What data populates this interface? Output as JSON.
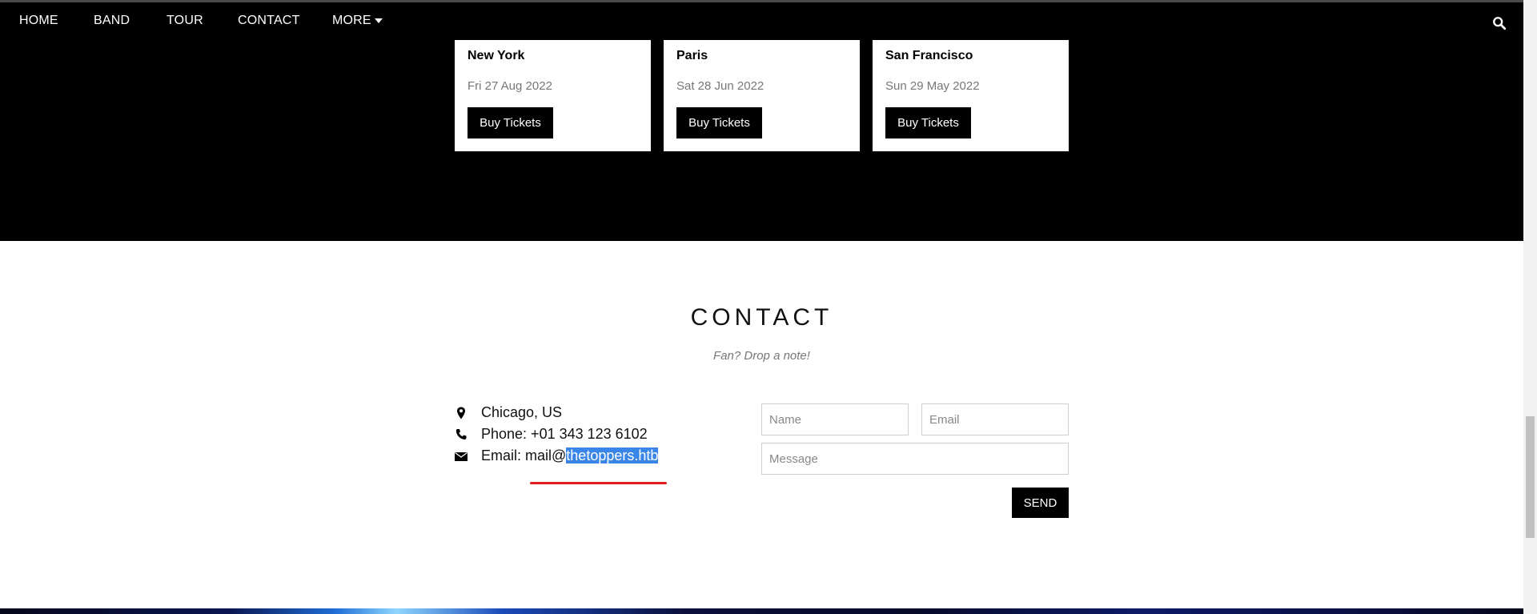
{
  "nav": {
    "items": [
      "HOME",
      "BAND",
      "TOUR",
      "CONTACT",
      "MORE"
    ],
    "search_icon": "search-icon"
  },
  "tour": {
    "cards": [
      {
        "city": "New York",
        "date": "Fri 27 Aug 2022",
        "button": "Buy Tickets"
      },
      {
        "city": "Paris",
        "date": "Sat 28 Jun 2022",
        "button": "Buy Tickets"
      },
      {
        "city": "San Francisco",
        "date": "Sun 29 May 2022",
        "button": "Buy Tickets"
      }
    ]
  },
  "contact": {
    "title": "CONTACT",
    "subtitle": "Fan? Drop a note!",
    "location": "Chicago, US",
    "phone": "Phone: +01 343 123 6102",
    "email_prefix": "Email: mail@",
    "email_domain": "thetoppers.htb",
    "form": {
      "name_placeholder": "Name",
      "email_placeholder": "Email",
      "message_placeholder": "Message",
      "send_label": "SEND"
    }
  },
  "colors": {
    "nav_bg": "#000000",
    "selection": "#3a86e8",
    "annotation_red": "#e21b1b"
  }
}
